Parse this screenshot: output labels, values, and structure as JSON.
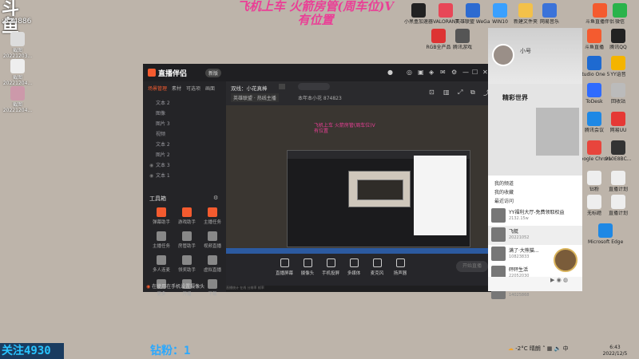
{
  "overlay": {
    "logo": "斗鱼",
    "logo_sub": ":524886",
    "banner_line1": "飞机上车 火箭房管(周车位)V",
    "banner_line2": "有位置",
    "counter": "关注4930",
    "fans": "钻粉：1"
  },
  "desktop_left": [
    {
      "label": "截图",
      "sub": "20221203...",
      "color": "#ddd"
    },
    {
      "label": "截图",
      "sub": "20221204...",
      "color": "#eee"
    },
    {
      "label": "截图",
      "sub": "20221204...",
      "color": "#c9a"
    }
  ],
  "desktop_top": [
    {
      "label": "小黑盒加速器",
      "color": "#222"
    },
    {
      "label": "VALORANT",
      "color": "#e84757"
    },
    {
      "label": "英雄联盟 WeGame版",
      "color": "#2d6bd1"
    },
    {
      "label": "WIN10",
      "color": "#3aa0ff"
    },
    {
      "label": "新建文件夹",
      "color": "#f3c14a"
    },
    {
      "label": "网易音乐",
      "color": "#3b73d9"
    },
    {
      "label": "斗鱼直播伴侣",
      "color": "#f45b2f"
    },
    {
      "label": "微信",
      "color": "#2ab34b"
    }
  ],
  "desktop_mid": [
    {
      "label": "RGB全产品",
      "color": "#d33"
    },
    {
      "label": "腾讯游戏",
      "color": "#555"
    }
  ],
  "desktop_right": [
    {
      "label": "斗鱼直播",
      "color": "#f45b2f"
    },
    {
      "label": "腾讯QQ",
      "color": "#222"
    },
    {
      "label": "Studio One 5",
      "color": "#1e6ad1"
    },
    {
      "label": "YY语音",
      "color": "#f4b400"
    },
    {
      "label": "ToDesk",
      "color": "#2f6bff"
    },
    {
      "label": "回收站",
      "color": "#bbb"
    },
    {
      "label": "腾讯会议",
      "color": "#1e88e5"
    },
    {
      "label": "网易UU",
      "color": "#e53935"
    },
    {
      "label": "Google Chrome",
      "color": "#e8453c"
    },
    {
      "label": "910E8BC...",
      "color": "#333"
    },
    {
      "label": "钻粉",
      "color": "#eee"
    },
    {
      "label": "直播计划",
      "color": "#eee"
    },
    {
      "label": "无标题",
      "color": "#eee"
    },
    {
      "label": "直播计划",
      "color": "#eee"
    },
    {
      "label": "Microsoft Edge",
      "color": "#1e88e5"
    }
  ],
  "app": {
    "name": "直播伴侣",
    "version": "新版",
    "side_tabs": [
      "场景管理",
      "素材",
      "可选项",
      "画面"
    ],
    "sources": [
      "文本 2",
      "图像",
      "图片 3",
      "视频",
      "文本 2",
      "图片 2",
      "文本 3",
      "文本 1"
    ],
    "tools_title": "工具箱",
    "tools": [
      {
        "label": "弹幕助手",
        "color": "#f45b2f"
      },
      {
        "label": "游戏助手",
        "color": "#f45b2f"
      },
      {
        "label": "主播任务",
        "color": "#f45b2f"
      },
      {
        "label": "主播任务",
        "color": "#888"
      },
      {
        "label": "房管助手",
        "color": "#888"
      },
      {
        "label": "视频直播",
        "color": "#888"
      },
      {
        "label": "多人连麦",
        "color": "#888"
      },
      {
        "label": "领奖助手",
        "color": "#888"
      },
      {
        "label": "虚拟直播",
        "color": "#888"
      },
      {
        "label": "更多",
        "color": "#888"
      },
      {
        "label": "开播",
        "color": "#888"
      },
      {
        "label": "下载",
        "color": "#888"
      }
    ],
    "footer_hint": "在使用在手机设置摄像头",
    "canvas_title": "双线：小花真棒",
    "canvas_sub": "英雄联盟 · 热线主播",
    "canvas_info": "本年本小花  874823",
    "inner_banner1": "飞机上车 火箭房管(周车位)V",
    "inner_banner2": "有位置",
    "bottom_items": [
      "直播屏幕",
      "摄像头",
      "手机投屏",
      "多媒体",
      "麦克风",
      "扬声器"
    ],
    "start_live": "开始直播",
    "status": "直播统计  在线  分辨率  帧率"
  },
  "phone": {
    "name": "小号",
    "hero_title": "精彩世界",
    "menu": [
      "我的频道",
      "我的收藏",
      "最近访问"
    ],
    "songs": [
      {
        "title": "YY福利大厅-免费领取权益",
        "sub": "2132.15w"
      },
      {
        "title": "飞艇",
        "sub": "20221052"
      },
      {
        "title": "满了·大熊猫...",
        "sub": "10823833"
      },
      {
        "title": "砰砰生活",
        "sub": "22052030"
      },
      {
        "title": "蔚蓝音乐",
        "sub": "14025868"
      }
    ]
  },
  "tray": {
    "weather": "-2°C 晴朗",
    "time": "6:43",
    "date": "2022/12/5"
  }
}
